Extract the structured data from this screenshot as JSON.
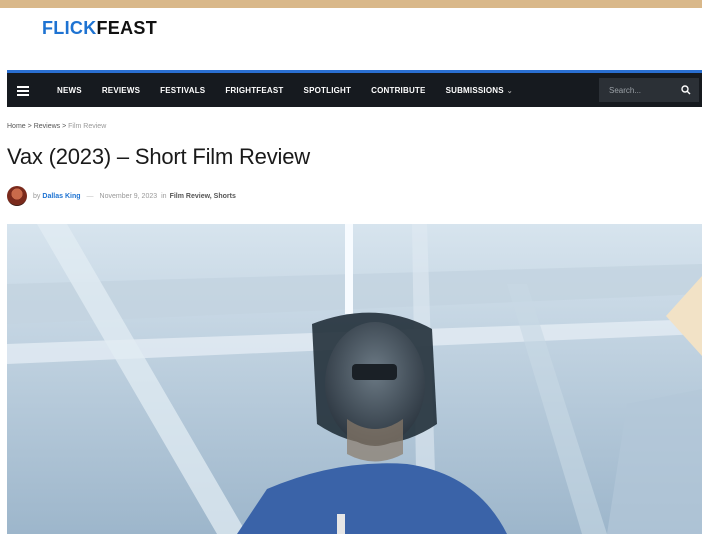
{
  "site": {
    "brand_part1": "FLICK",
    "brand_part2": "FEAST"
  },
  "nav": {
    "items": [
      "NEWS",
      "REVIEWS",
      "FESTIVALS",
      "FRIGHTFEAST",
      "SPOTLIGHT",
      "CONTRIBUTE",
      "SUBMISSIONS"
    ],
    "search_placeholder": "Search..."
  },
  "breadcrumb": {
    "home": "Home",
    "sep": ">",
    "reviews": "Reviews",
    "current": "Film Review"
  },
  "article": {
    "title": "Vax (2023) – Short Film Review",
    "by": "by",
    "author": "Dallas King",
    "dash": "—",
    "date": "November 9, 2023",
    "in": "in",
    "categories": "Film Review, Shorts"
  },
  "icons": {
    "menu": "hamburger-menu-icon",
    "search": "search-icon",
    "next": "chevron-left-icon"
  },
  "colors": {
    "brand_blue": "#1e73d2",
    "nav_bg": "#161a1f",
    "accent": "#2a6fd1"
  }
}
